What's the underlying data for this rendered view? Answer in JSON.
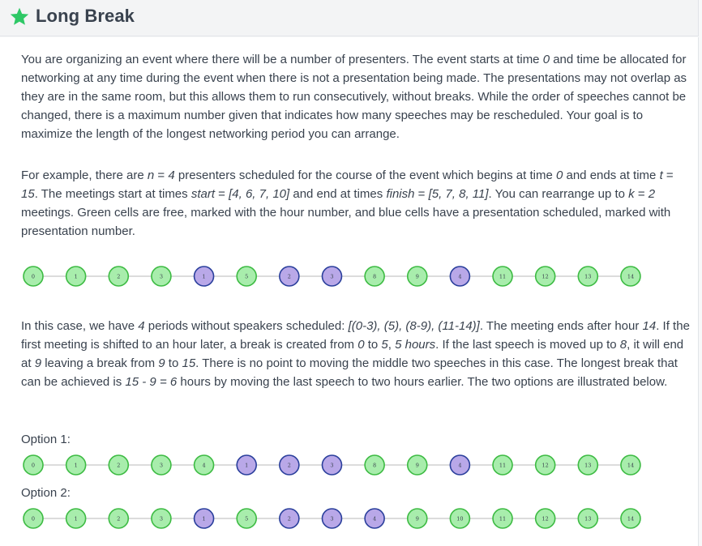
{
  "header": {
    "title": "Long Break"
  },
  "paragraphs": {
    "p1": [
      {
        "t": "You are organizing an event where there will be a number of presenters. The event starts at time "
      },
      {
        "t": "0",
        "i": true
      },
      {
        "t": " and time be allocated for networking at any time during the event when there is not a presentation being made. The presentations may not overlap as they are in the same room, but this allows them to run consecutively, without breaks. While the order of speeches cannot be changed, there is a maximum number given that indicates how many speeches may be rescheduled. Your goal is to maximize the length of the longest networking period you can arrange."
      }
    ],
    "p2": [
      {
        "t": "For example, there are "
      },
      {
        "t": "n",
        "i": true
      },
      {
        "t": " = "
      },
      {
        "t": "4",
        "i": true
      },
      {
        "t": " presenters scheduled for the course of the event which begins at time "
      },
      {
        "t": "0",
        "i": true
      },
      {
        "t": " and ends at time "
      },
      {
        "t": "t",
        "i": true
      },
      {
        "t": " = "
      },
      {
        "t": "15",
        "i": true
      },
      {
        "t": ". The meetings start at times "
      },
      {
        "t": "start",
        "i": true
      },
      {
        "t": " = "
      },
      {
        "t": "[4, 6, 7, 10]",
        "i": true
      },
      {
        "t": " and end at times "
      },
      {
        "t": "finish",
        "i": true
      },
      {
        "t": " = "
      },
      {
        "t": "[5, 7, 8, 11]",
        "i": true
      },
      {
        "t": ". You can rearrange up to "
      },
      {
        "t": "k",
        "i": true
      },
      {
        "t": " = "
      },
      {
        "t": "2",
        "i": true
      },
      {
        "t": " meetings. Green cells are free, marked with the hour number, and blue cells have a presentation scheduled, marked with presentation number."
      }
    ],
    "p3": [
      {
        "t": "In this case, we have "
      },
      {
        "t": "4",
        "i": true
      },
      {
        "t": " periods without speakers scheduled: "
      },
      {
        "t": "[(0-3), (5), (8-9), (11-14)]",
        "i": true
      },
      {
        "t": ". The meeting ends after hour "
      },
      {
        "t": "14",
        "i": true
      },
      {
        "t": ". If the first meeting is shifted to an hour later, a break is created from "
      },
      {
        "t": "0",
        "i": true
      },
      {
        "t": " to "
      },
      {
        "t": "5",
        "i": true
      },
      {
        "t": ", "
      },
      {
        "t": "5 hours",
        "i": true
      },
      {
        "t": ". If the last speech is moved up to "
      },
      {
        "t": "8",
        "i": true
      },
      {
        "t": ", it will end at "
      },
      {
        "t": "9",
        "i": true
      },
      {
        "t": " leaving a break from "
      },
      {
        "t": "9",
        "i": true
      },
      {
        "t": " to "
      },
      {
        "t": "15",
        "i": true
      },
      {
        "t": ". There is no point to moving the middle two speeches in this case. The longest break that can be achieved is "
      },
      {
        "t": "15 - 9 = 6",
        "i": true
      },
      {
        "t": " hours by moving the last speech to two hours earlier. The two options are illustrated below."
      }
    ]
  },
  "options": {
    "option1": "Option 1:",
    "option2": "Option 2:"
  },
  "colors": {
    "free_fill": "#a8edac",
    "free_stroke": "#3dbb43",
    "busy_fill": "#b9a8e8",
    "busy_stroke": "#2a3f9c",
    "line": "#c6c6c6",
    "star": "#2ec866"
  },
  "rows": {
    "original": [
      {
        "label": "0",
        "kind": "free"
      },
      {
        "label": "1",
        "kind": "free"
      },
      {
        "label": "2",
        "kind": "free"
      },
      {
        "label": "3",
        "kind": "free"
      },
      {
        "label": "1",
        "kind": "busy"
      },
      {
        "label": "5",
        "kind": "free"
      },
      {
        "label": "2",
        "kind": "busy"
      },
      {
        "label": "3",
        "kind": "busy"
      },
      {
        "label": "8",
        "kind": "free"
      },
      {
        "label": "9",
        "kind": "free"
      },
      {
        "label": "4",
        "kind": "busy"
      },
      {
        "label": "11",
        "kind": "free"
      },
      {
        "label": "12",
        "kind": "free"
      },
      {
        "label": "13",
        "kind": "free"
      },
      {
        "label": "14",
        "kind": "free"
      }
    ],
    "option1": [
      {
        "label": "0",
        "kind": "free"
      },
      {
        "label": "1",
        "kind": "free"
      },
      {
        "label": "2",
        "kind": "free"
      },
      {
        "label": "3",
        "kind": "free"
      },
      {
        "label": "4",
        "kind": "free"
      },
      {
        "label": "1",
        "kind": "busy"
      },
      {
        "label": "2",
        "kind": "busy"
      },
      {
        "label": "3",
        "kind": "busy"
      },
      {
        "label": "8",
        "kind": "free"
      },
      {
        "label": "9",
        "kind": "free"
      },
      {
        "label": "4",
        "kind": "busy"
      },
      {
        "label": "11",
        "kind": "free"
      },
      {
        "label": "12",
        "kind": "free"
      },
      {
        "label": "13",
        "kind": "free"
      },
      {
        "label": "14",
        "kind": "free"
      }
    ],
    "option2": [
      {
        "label": "0",
        "kind": "free"
      },
      {
        "label": "1",
        "kind": "free"
      },
      {
        "label": "2",
        "kind": "free"
      },
      {
        "label": "3",
        "kind": "free"
      },
      {
        "label": "1",
        "kind": "busy"
      },
      {
        "label": "5",
        "kind": "free"
      },
      {
        "label": "2",
        "kind": "busy"
      },
      {
        "label": "3",
        "kind": "busy"
      },
      {
        "label": "4",
        "kind": "busy"
      },
      {
        "label": "9",
        "kind": "free"
      },
      {
        "label": "10",
        "kind": "free"
      },
      {
        "label": "11",
        "kind": "free"
      },
      {
        "label": "12",
        "kind": "free"
      },
      {
        "label": "13",
        "kind": "free"
      },
      {
        "label": "14",
        "kind": "free"
      }
    ]
  }
}
